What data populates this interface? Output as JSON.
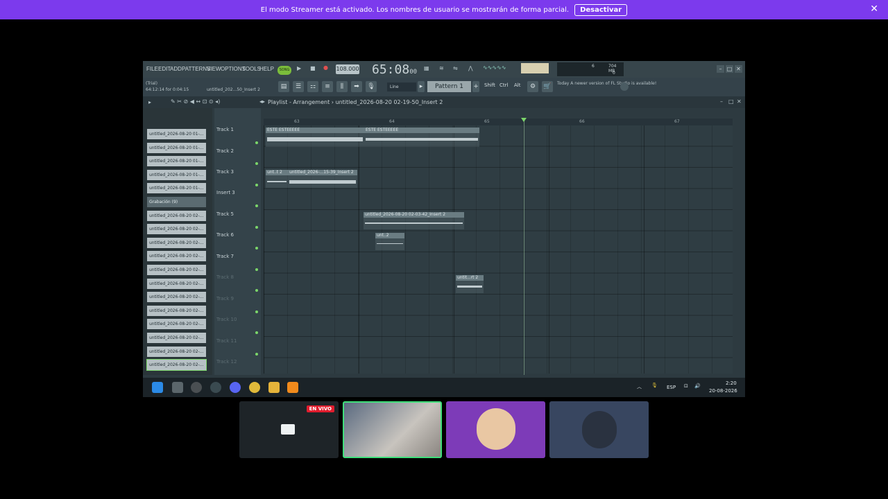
{
  "banner": {
    "message": "El modo Streamer está activado. Los nombres de usuario se mostrarán de forma parcial.",
    "button": "Desactivar"
  },
  "menu": [
    "FILE",
    "EDIT",
    "ADD",
    "PATTERNS",
    "VIEW",
    "OPTIONS",
    "TOOLS",
    "HELP"
  ],
  "transport": {
    "song_mode": "SONG",
    "bpm": "108.000",
    "time": "65:08",
    "time_sub": "00",
    "cpu_val": "6",
    "ram": "704 MB",
    "poly": "0"
  },
  "toolbar": {
    "trial": "(Trial)",
    "trial_time": "64:12:14 for 0:04:15",
    "project": "untitled_202...50_Insert 2",
    "snap": "Line",
    "pattern": "Pattern 1",
    "keys": [
      "Shift",
      "Ctrl",
      "Alt"
    ],
    "news_date": "Today",
    "news": "A newer version of FL Studio is available!"
  },
  "playlist": {
    "title": "Playlist - Arrangement › untitled_2026-08-20 02-19-50_Insert 2",
    "ruler": [
      "63",
      "64",
      "65",
      "66",
      "67"
    ],
    "tracks": [
      "Track 1",
      "Track 2",
      "Track 3",
      "Insert 3",
      "Track 5",
      "Track 6",
      "Track 7",
      "Track 8",
      "Track 9",
      "Track 10",
      "Track 11",
      "Track 12"
    ],
    "clips": [
      "ESTE ESTEEEEE",
      "ESTE ESTEEEEE",
      "unt..t 2",
      "untitled_2026-...15-39_Insert 2",
      "untitled_2026-08-20 02-03-42_Insert 2",
      "unt..2",
      "untit...rt 2"
    ]
  },
  "browser": {
    "items": [
      "untitled_2026-08-20 01-...",
      "untitled_2026-08-20 01-...",
      "untitled_2026-08-20 01-...",
      "untitled_2026-08-20 01-...",
      "untitled_2026-08-20 01-...",
      "Grabación (9)",
      "untitled_2026-08-20 02-...",
      "untitled_2026-08-20 02-...",
      "untitled_2026-08-20 02-...",
      "untitled_2026-08-20 02-...",
      "untitled_2026-08-20 02-...",
      "untitled_2026-08-20 02-...",
      "untitled_2026-08-20 02-...",
      "untitled_2026-08-20 02-...",
      "untitled_2026-08-20 02-...",
      "untitled_2026-08-20 02-...",
      "untitled_2026-08-20 02-...",
      "untitled_2026-08-20 02-..."
    ]
  },
  "taskbar": {
    "lang": "ESP",
    "time": "2:20",
    "date": "20-08-2026"
  },
  "stream": {
    "live": "EN VIVO"
  }
}
